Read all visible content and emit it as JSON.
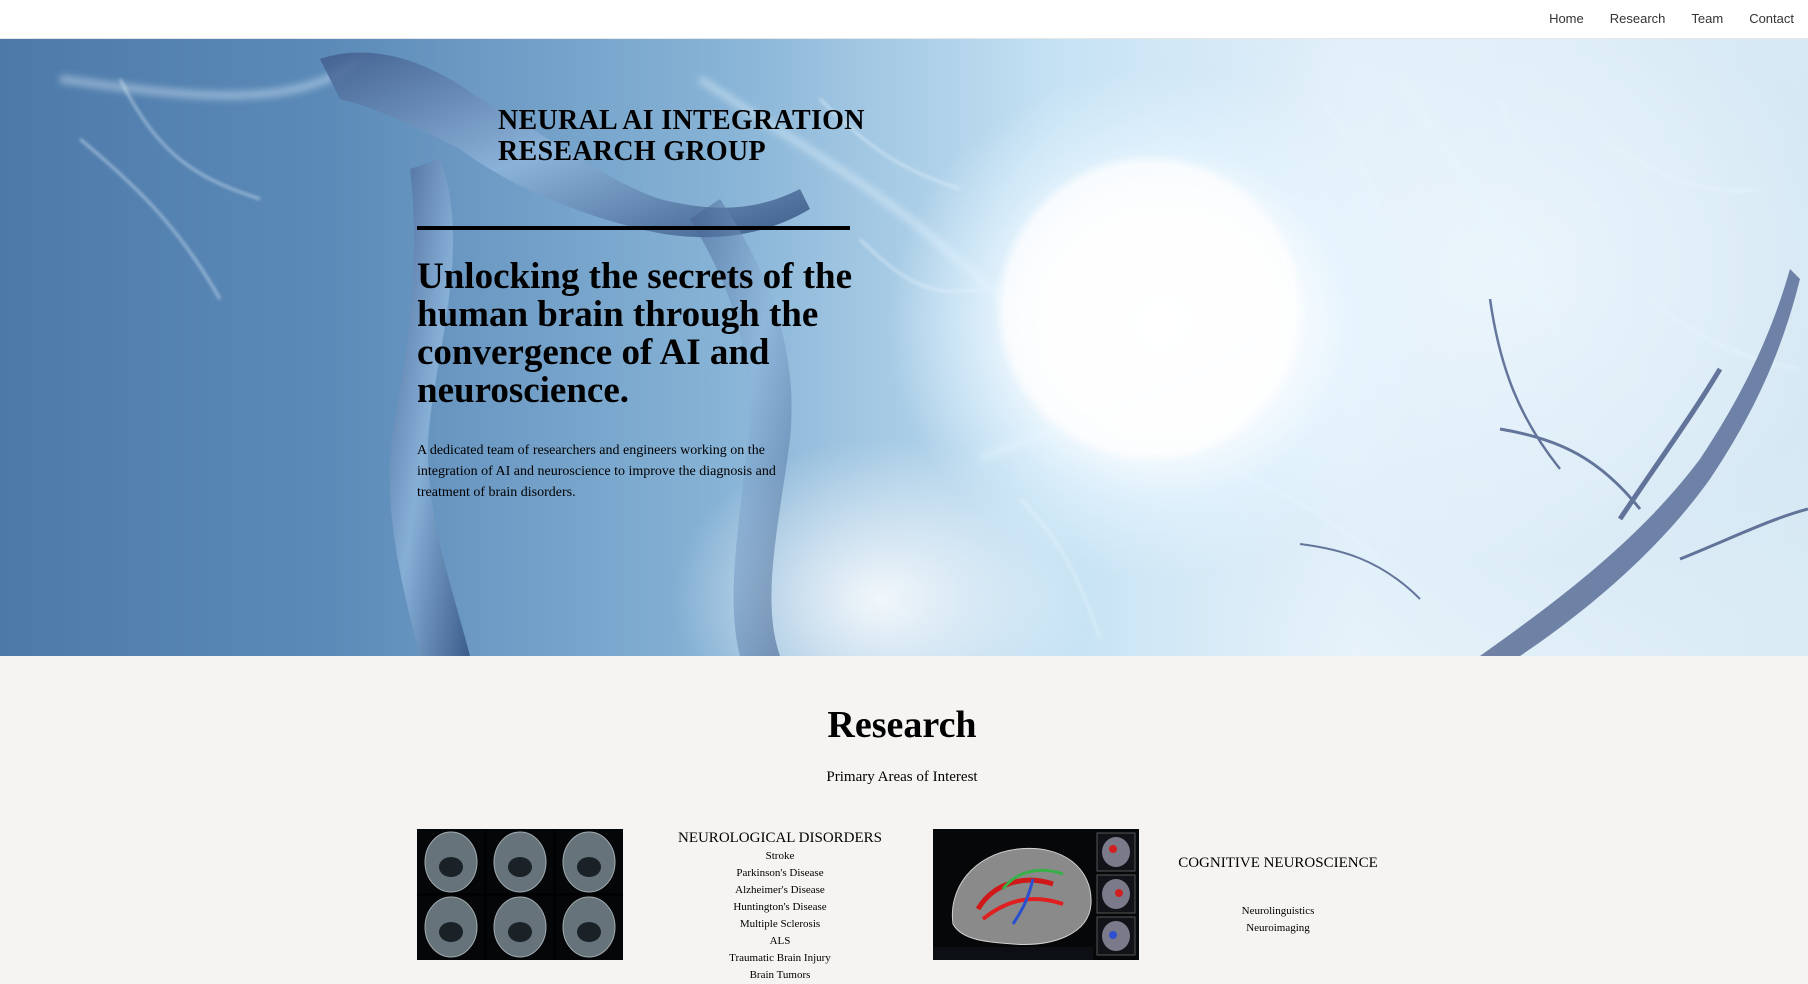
{
  "nav": {
    "links": [
      "Home",
      "Research",
      "Team",
      "Contact"
    ]
  },
  "hero": {
    "title": "NEURAL AI INTEGRATION RESEARCH GROUP",
    "headline": "Unlocking the secrets of the human brain through the convergence of AI and neuroscience.",
    "description": "A dedicated team of researchers and engineers working on the integration of AI and neuroscience to improve the diagnosis and treatment of brain disorders."
  },
  "research": {
    "heading": "Research",
    "subheading": "Primary Areas of Interest",
    "areas": [
      {
        "title": "NEUROLOGICAL DISORDERS",
        "items": [
          "Stroke",
          "Parkinson's Disease",
          "Alzheimer's Disease",
          "Huntington's Disease",
          "Multiple Sclerosis",
          "ALS",
          "Traumatic Brain Injury",
          "Brain Tumors"
        ]
      },
      {
        "title": "COGNITIVE NEUROSCIENCE",
        "items": [
          "Neurolinguistics",
          "Neuroimaging"
        ]
      }
    ]
  },
  "colors": {
    "nav_bg": "#ffffff",
    "section_bg": "#f5f4f2",
    "text": "#000000"
  }
}
